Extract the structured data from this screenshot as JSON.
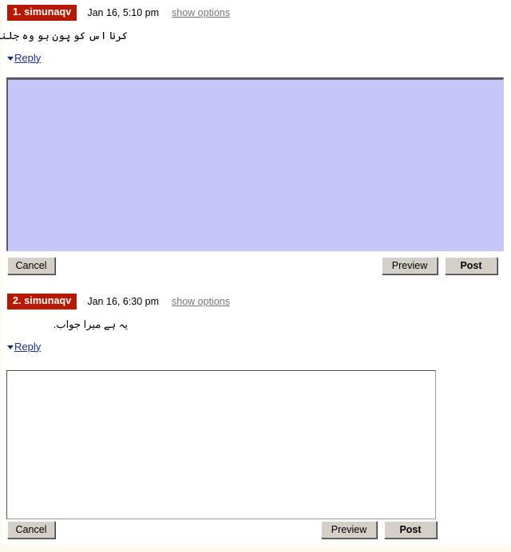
{
  "page": {
    "background_color": "#ffffff",
    "gutter_color": "#fdfbf0",
    "badge_color": "#b51a00",
    "link_color": "#1a2f8f",
    "muted_link_color": "#767676",
    "selected_textarea_color": "#c6c6fb",
    "button_face_color": "#d4d0c8"
  },
  "posts": [
    {
      "author": "1. simunaqv",
      "date": "Jan 16, 5:10 pm",
      "options_label": "show options",
      "body_text": "کرنا اس کو پون ہو وہ جلنا ہے.",
      "reply_label": "Reply",
      "reply_toggle_icon": "triangle-down-icon",
      "textarea": {
        "value": "",
        "placeholder": "",
        "selected": true
      },
      "buttons": {
        "cancel": "Cancel",
        "preview": "Preview",
        "post": "Post"
      }
    },
    {
      "author": "2. simunaqv",
      "date": "Jan 16, 6:30 pm",
      "options_label": "show options",
      "body_text": "یہ ہے میرا جواب.",
      "reply_label": "Reply",
      "reply_toggle_icon": "triangle-down-icon",
      "textarea": {
        "value": "",
        "placeholder": "",
        "selected": false
      },
      "buttons": {
        "cancel": "Cancel",
        "preview": "Preview",
        "post": "Post"
      }
    }
  ]
}
